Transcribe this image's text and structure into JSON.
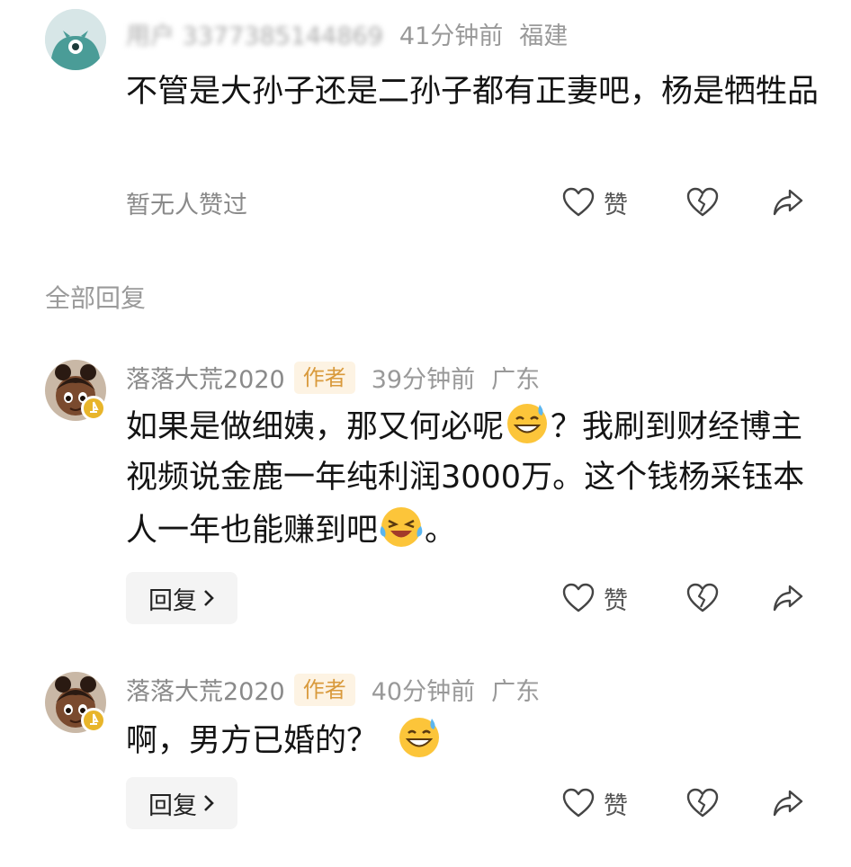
{
  "comments": [
    {
      "username": "用户 3377385144869",
      "time": "41分钟前",
      "location": "福建",
      "text": "不管是大孙子还是二孙子都有正妻吧，杨是牺牲品",
      "likes_text": "暂无人赞过",
      "like_label": "赞"
    }
  ],
  "section_title": "全部回复",
  "replies": [
    {
      "username": "落落大荒2020",
      "author_tag": "作者",
      "time": "39分钟前",
      "location": "广东",
      "text_part1": "如果是做细姨，那又何必呢",
      "text_part2": "？我刷到财经博主视频说金鹿一年纯利润3000万。这个钱杨采钰本人一年也能赚到吧",
      "text_part3": "。",
      "emoji1": "grinning-sweat-emoji",
      "emoji2": "rolling-laughing-emoji",
      "reply_label": "回复",
      "like_label": "赞"
    },
    {
      "username": "落落大荒2020",
      "author_tag": "作者",
      "time": "40分钟前",
      "location": "广东",
      "text_part1": "啊，男方已婚的？",
      "emoji1": "grinning-sweat-emoji",
      "reply_label": "回复",
      "like_label": "赞"
    }
  ],
  "colors": {
    "author_tag_bg": "#fdf3e3",
    "author_tag_text": "#d99a3c",
    "meta_gray": "#999999",
    "avatar_teal": "#4a9c97"
  }
}
